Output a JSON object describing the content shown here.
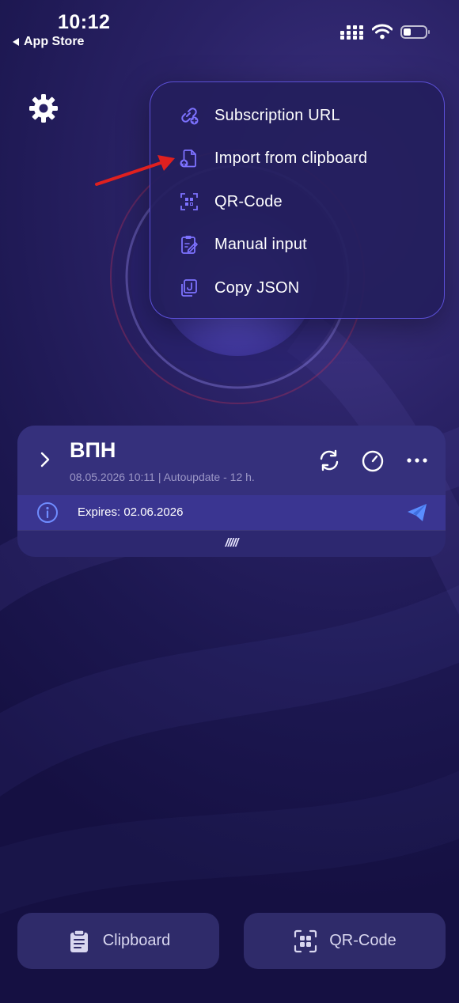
{
  "status_bar": {
    "time": "10:12",
    "back_label": "App Store"
  },
  "menu": {
    "items": [
      {
        "label": "Subscription URL",
        "icon": "link-plus-icon"
      },
      {
        "label": "Import from clipboard",
        "icon": "file-import-icon"
      },
      {
        "label": "QR-Code",
        "icon": "qr-scan-icon"
      },
      {
        "label": "Manual input",
        "icon": "clipboard-edit-icon"
      },
      {
        "label": "Copy JSON",
        "icon": "copy-json-icon"
      }
    ]
  },
  "config_card": {
    "title": "ВПН",
    "subtitle": "08.05.2026 10:11 | Autoupdate - 12 h.",
    "expires": "Expires: 02.06.2026",
    "handle": "/////"
  },
  "bottom_buttons": {
    "clipboard_label": "Clipboard",
    "qr_label": "QR-Code"
  },
  "colors": {
    "accent": "#6f66f0",
    "menu_border": "#5b4fd6",
    "annotation_arrow": "#e0201f",
    "send_icon": "#5a8dff"
  }
}
